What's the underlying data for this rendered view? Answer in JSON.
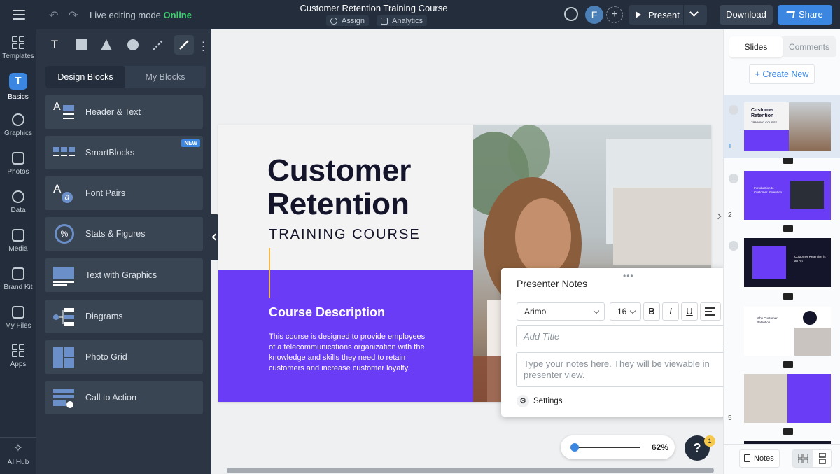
{
  "topbar": {
    "mode_label": "Live editing mode",
    "mode_status": "Online",
    "title": "Customer Retention Training Course",
    "assign": "Assign",
    "analytics": "Analytics",
    "avatar_letter": "F",
    "present": "Present",
    "download": "Download",
    "share": "Share"
  },
  "rail": {
    "items": [
      {
        "label": "Templates",
        "icon": "templates-icon"
      },
      {
        "label": "Basics",
        "icon": "basics-icon",
        "glyph": "T"
      },
      {
        "label": "Graphics",
        "icon": "graphics-icon"
      },
      {
        "label": "Photos",
        "icon": "photos-icon"
      },
      {
        "label": "Data",
        "icon": "data-icon"
      },
      {
        "label": "Media",
        "icon": "media-icon"
      },
      {
        "label": "Brand Kit",
        "icon": "brand-kit-icon"
      },
      {
        "label": "My Files",
        "icon": "folder-icon"
      },
      {
        "label": "Apps",
        "icon": "apps-icon"
      },
      {
        "label": "AI Hub",
        "icon": "sparkle-icon"
      }
    ]
  },
  "panel": {
    "tools": {
      "text": "T"
    },
    "tabs": [
      "Design Blocks",
      "My Blocks"
    ],
    "blocks": [
      {
        "label": "Header & Text"
      },
      {
        "label": "SmartBlocks",
        "badge": "NEW"
      },
      {
        "label": "Font Pairs"
      },
      {
        "label": "Stats & Figures"
      },
      {
        "label": "Text with Graphics"
      },
      {
        "label": "Diagrams"
      },
      {
        "label": "Photo Grid"
      },
      {
        "label": "Call to Action"
      }
    ],
    "icon_glyphs": {
      "header": "A",
      "font_pairs_a": "A",
      "font_pairs_b": "a",
      "stats": "%"
    }
  },
  "slide": {
    "title_line1": "Customer",
    "title_line2": "Retention",
    "subtitle": "TRAINING COURSE",
    "desc_heading": "Course Description",
    "desc_text": "This course is designed to provide employees of a telecommunications organization with the knowledge and skills they need to retain customers and increase customer loyalty.",
    "accent_color": "#6a3cf5"
  },
  "notes": {
    "title": "Presenter Notes",
    "font": "Arimo",
    "size": "16",
    "bold": "B",
    "italic": "I",
    "underline": "U",
    "title_placeholder": "Add Title",
    "notes_placeholder": "Type your notes here. They will be viewable in presenter view.",
    "settings": "Settings"
  },
  "rpanel": {
    "tabs": [
      "Slides",
      "Comments"
    ],
    "create_new": "Create New",
    "slides": [
      {
        "number": "1",
        "title": "Customer Retention",
        "subtitle": "TRAINING COURSE"
      },
      {
        "number": "2",
        "title": "Introduction to Customer Retention"
      },
      {
        "number": "",
        "title": "Customer Retention is an Art"
      },
      {
        "number": "",
        "title": "Why Customer Retention"
      },
      {
        "number": "5"
      }
    ],
    "notes_button": "Notes"
  },
  "zoom": {
    "value": "62%"
  },
  "help": {
    "label": "?",
    "badge": "1"
  }
}
